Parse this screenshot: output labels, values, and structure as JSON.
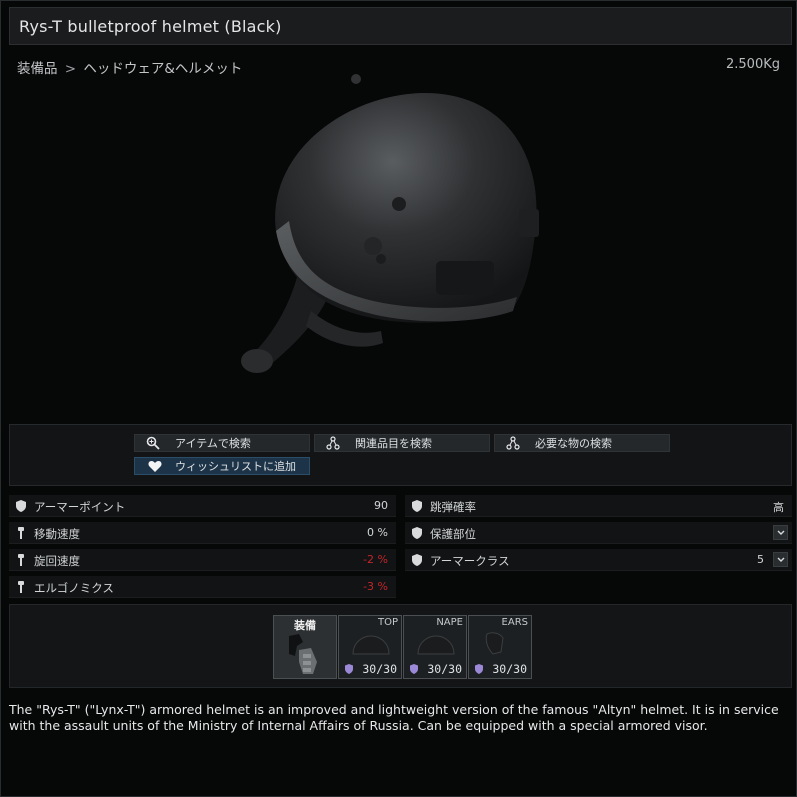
{
  "window": {
    "title": "Rys-T bulletproof helmet (Black)"
  },
  "breadcrumb": {
    "category": "装備品",
    "separator": ">",
    "subcategory": "ヘッドウェア&ヘルメット"
  },
  "weight": "2.500Kg",
  "actions": {
    "search_item": "アイテムで検索",
    "search_related": "関連品目を検索",
    "search_required": "必要な物の検索",
    "add_wishlist": "ウィッシュリストに追加"
  },
  "stats_left": [
    {
      "label": "アーマーポイント",
      "value": "90",
      "icon": "shield-icon"
    },
    {
      "label": "移動速度",
      "value": "0 %",
      "icon": "weight-icon"
    },
    {
      "label": "旋回速度",
      "value": "-2 %",
      "icon": "weight-icon",
      "negative": true
    },
    {
      "label": "エルゴノミクス",
      "value": "-3 %",
      "icon": "weight-icon",
      "negative": true
    }
  ],
  "stats_right": [
    {
      "label": "跳弾確率",
      "value": "高",
      "icon": "shield-icon"
    },
    {
      "label": "保護部位",
      "value": "",
      "icon": "shield-icon",
      "dropdown": true
    },
    {
      "label": "アーマークラス",
      "value": "5",
      "icon": "shield-icon",
      "dropdown": true
    }
  ],
  "slots": {
    "equip_label": "装備",
    "items": [
      {
        "name": "TOP",
        "durability": "30/30"
      },
      {
        "name": "NAPE",
        "durability": "30/30"
      },
      {
        "name": "EARS",
        "durability": "30/30"
      }
    ]
  },
  "description": "The \"Rys-T\" (\"Lynx-T\") armored helmet is an improved and lightweight version of the famous \"Altyn\" helmet. It is in service with the assault units of the Ministry of Internal Affairs of Russia. Can be equipped with a special armored visor.",
  "colors": {
    "negative": "#c4262b",
    "wishlist_bg": "#1d3347",
    "background": "#060707"
  }
}
